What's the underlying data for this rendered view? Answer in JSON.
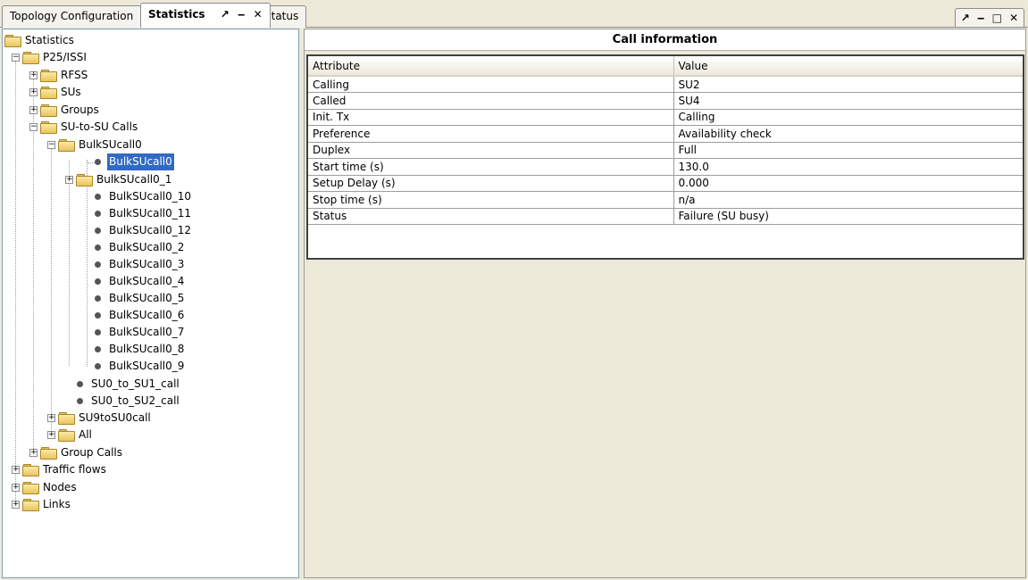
{
  "tabs": [
    {
      "label": "Topology Configuration"
    },
    {
      "label": "Statistics",
      "controls": [
        "↗",
        "‒",
        "✕"
      ]
    },
    {
      "label": "Status"
    }
  ],
  "window_controls": [
    "↗",
    "‒",
    "□",
    "✕"
  ],
  "tree": {
    "root": "Statistics",
    "p25": "P25/ISSI",
    "rfss": "RFSS",
    "sus": "SUs",
    "groups": "Groups",
    "su_calls": "SU-to-SU Calls",
    "bulk": "BulkSUcall0",
    "bulk_items": [
      "BulkSUcall0",
      "BulkSUcall0_1",
      "BulkSUcall0_10",
      "BulkSUcall0_11",
      "BulkSUcall0_12",
      "BulkSUcall0_2",
      "BulkSUcall0_3",
      "BulkSUcall0_4",
      "BulkSUcall0_5",
      "BulkSUcall0_6",
      "BulkSUcall0_7",
      "BulkSUcall0_8",
      "BulkSUcall0_9"
    ],
    "su0_su1": "SU0_to_SU1_call",
    "su0_su2": "SU0_to_SU2_call",
    "su9": "SU9toSU0call",
    "all": "All",
    "group_calls": "Group Calls",
    "traffic": "Traffic flows",
    "nodes": "Nodes",
    "links": "Links"
  },
  "detail": {
    "title": "Call information",
    "columns": [
      "Attribute",
      "Value"
    ],
    "rows": [
      [
        "Calling",
        "SU2"
      ],
      [
        "Called",
        "SU4"
      ],
      [
        "Init. Tx",
        "Calling"
      ],
      [
        "Preference",
        "Availability check"
      ],
      [
        "Duplex",
        "Full"
      ],
      [
        "Start time (s)",
        "130.0"
      ],
      [
        "Setup Delay (s)",
        "0.000"
      ],
      [
        "Stop time (s)",
        "n/a"
      ],
      [
        "Status",
        "Failure (SU busy)"
      ]
    ]
  }
}
